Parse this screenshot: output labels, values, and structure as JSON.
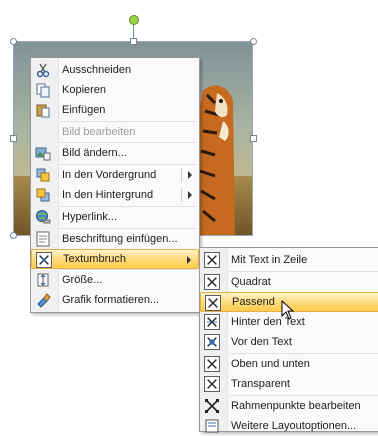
{
  "context_menu": {
    "items": [
      {
        "label": "Ausschneiden",
        "icon": "scissors-icon",
        "enabled": true
      },
      {
        "label": "Kopieren",
        "icon": "copy-icon",
        "enabled": true
      },
      {
        "label": "Einfügen",
        "icon": "paste-icon",
        "enabled": true
      },
      {
        "label": "Bild bearbeiten",
        "icon": "",
        "enabled": false
      },
      {
        "label": "Bild ändern...",
        "icon": "change-picture-icon",
        "enabled": true
      },
      {
        "label": "In den Vordergrund",
        "icon": "bring-to-front-icon",
        "enabled": true,
        "submenu": true
      },
      {
        "label": "In den Hintergrund",
        "icon": "send-to-back-icon",
        "enabled": true,
        "submenu": true
      },
      {
        "label": "Hyperlink...",
        "icon": "hyperlink-icon",
        "enabled": true
      },
      {
        "label": "Beschriftung einfügen...",
        "icon": "insert-caption-icon",
        "enabled": true
      },
      {
        "label": "Textumbruch",
        "icon": "text-wrap-icon",
        "enabled": true,
        "submenu": true,
        "highlighted": true
      },
      {
        "label": "Größe...",
        "icon": "size-icon",
        "enabled": true
      },
      {
        "label": "Grafik formatieren...",
        "icon": "format-picture-icon",
        "enabled": true
      }
    ]
  },
  "wrap_submenu": {
    "items": [
      {
        "label": "Mit Text in Zeile",
        "icon": "inline-with-text-icon"
      },
      {
        "label": "Quadrat",
        "icon": "square-wrap-icon"
      },
      {
        "label": "Passend",
        "icon": "tight-wrap-icon",
        "highlighted": true
      },
      {
        "label": "Hinter den Text",
        "icon": "behind-text-icon"
      },
      {
        "label": "Vor den Text",
        "icon": "in-front-of-text-icon"
      },
      {
        "label": "Oben und unten",
        "icon": "top-bottom-icon"
      },
      {
        "label": "Transparent",
        "icon": "through-wrap-icon"
      },
      {
        "label": "Rahmenpunkte bearbeiten",
        "icon": "edit-wrap-points-icon"
      },
      {
        "label": "Weitere Layoutoptionen...",
        "icon": "more-layout-options-icon"
      }
    ]
  },
  "colors": {
    "highlight": "#ffd978",
    "menu_background": "#fafafa",
    "selection_handle": "#7c8796",
    "rotation_handle": "#9bd24a"
  }
}
